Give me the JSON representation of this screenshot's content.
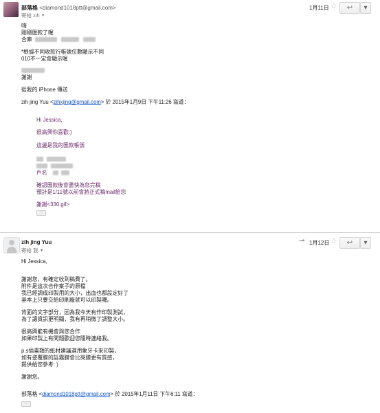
{
  "message1": {
    "sender_name": "部落格",
    "sender_email": "<diamond1018ptt@gmail.com>",
    "to": "寄給 zih",
    "date": "1月11日",
    "body": {
      "greeting": "嗨",
      "line2": "剛剛匯款了喔",
      "line3": "合庫",
      "note1": "*根據不同收款行帳號位數顯示不同",
      "note2": "010不一定會顯示喔",
      "thanks": "謝謝",
      "sent_from": "從我的 iPhone 傳送"
    },
    "quote_header": {
      "prefix": "zih jing Yuu <",
      "email": "zihxjing@gmail.com",
      "suffix": "> 於 2015年1月9日 下午11:26 寫道："
    },
    "quote": {
      "hi": "Hi Jessica,",
      "happy": "很高興你喜歡:)",
      "account": "這邊是我的匯款帳號",
      "holder": "戶名",
      "confirm1": "確認匯款後會盡快為您完稿",
      "confirm2": "預計是1/11號以前會將正式稿mail給您",
      "thanks": "謝謝<330.gif>"
    }
  },
  "message2": {
    "sender_name": "zih jing Yuu",
    "to": "寄給 我",
    "date": "1月12日",
    "body": {
      "hi": "Hi Jessica,",
      "p1": [
        "謝謝您，有確定收到稿費了。",
        "附件是這次合作案子的原檔",
        "我已經調成印製用的大小，出血也都設定好了",
        "基本上只要交給印刷廠就可以印製囉。"
      ],
      "p2": [
        "背面的文字部分，因為我今天有作印製測試，",
        "為了讓資訊更明顯，我有再稍微了調整大小。"
      ],
      "p3": [
        "很高興能有機會與您合作",
        "如果印製上有問題歡迎您隨時連絡我。"
      ],
      "p4": [
        "p.s插畫類的紙材建議選用象牙卡來印製，",
        "如有姿覆膜的話霧膜會比亮膜更有質感，",
        "提供給您參考: )"
      ],
      "thanks": "謝謝您。"
    },
    "quote_header": {
      "prefix": "部落格 <",
      "email": "diamond1018ptt@gmail.com",
      "suffix": "> 於 2015年1月11日 下午6:11 寫道："
    }
  },
  "icons": {
    "star": "☆",
    "reply": "↩",
    "more": "▾",
    "clip": "⊸"
  }
}
